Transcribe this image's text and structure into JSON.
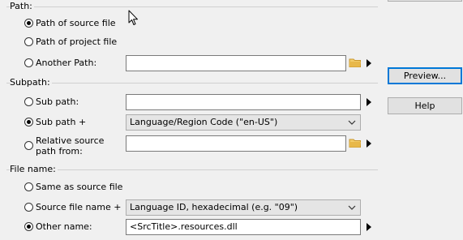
{
  "sections": {
    "path": {
      "label": "Path:",
      "options": {
        "source": "Path of source file",
        "project": "Path of project file",
        "another": "Another Path:"
      },
      "another_value": ""
    },
    "subpath": {
      "label": "Subpath:",
      "options": {
        "sub": "Sub path:",
        "sub_plus": "Sub path +",
        "relative": "Relative source path from:"
      },
      "sub_value": "",
      "sub_plus_selected": "Language/Region Code (\"en-US\")",
      "relative_value": ""
    },
    "filename": {
      "label": "File name:",
      "options": {
        "same": "Same as source file",
        "source_plus": "Source file name +",
        "other": "Other name:"
      },
      "source_plus_selected": "Language ID, hexadecimal (e.g. \"09\")",
      "other_value": "<SrcTitle>.resources.dll"
    }
  },
  "buttons": {
    "preview": "Preview...",
    "help": "Help"
  },
  "selected": {
    "path": "source",
    "subpath": "sub_plus",
    "filename": "other"
  },
  "icons": {
    "folder": "folder-icon",
    "arrow": "arrow-right-icon",
    "chevron": "chevron-down-icon",
    "cursor": "mouse-cursor-icon"
  },
  "colors": {
    "folder": "#e8b84a",
    "default_button_border": "#0078d7"
  }
}
